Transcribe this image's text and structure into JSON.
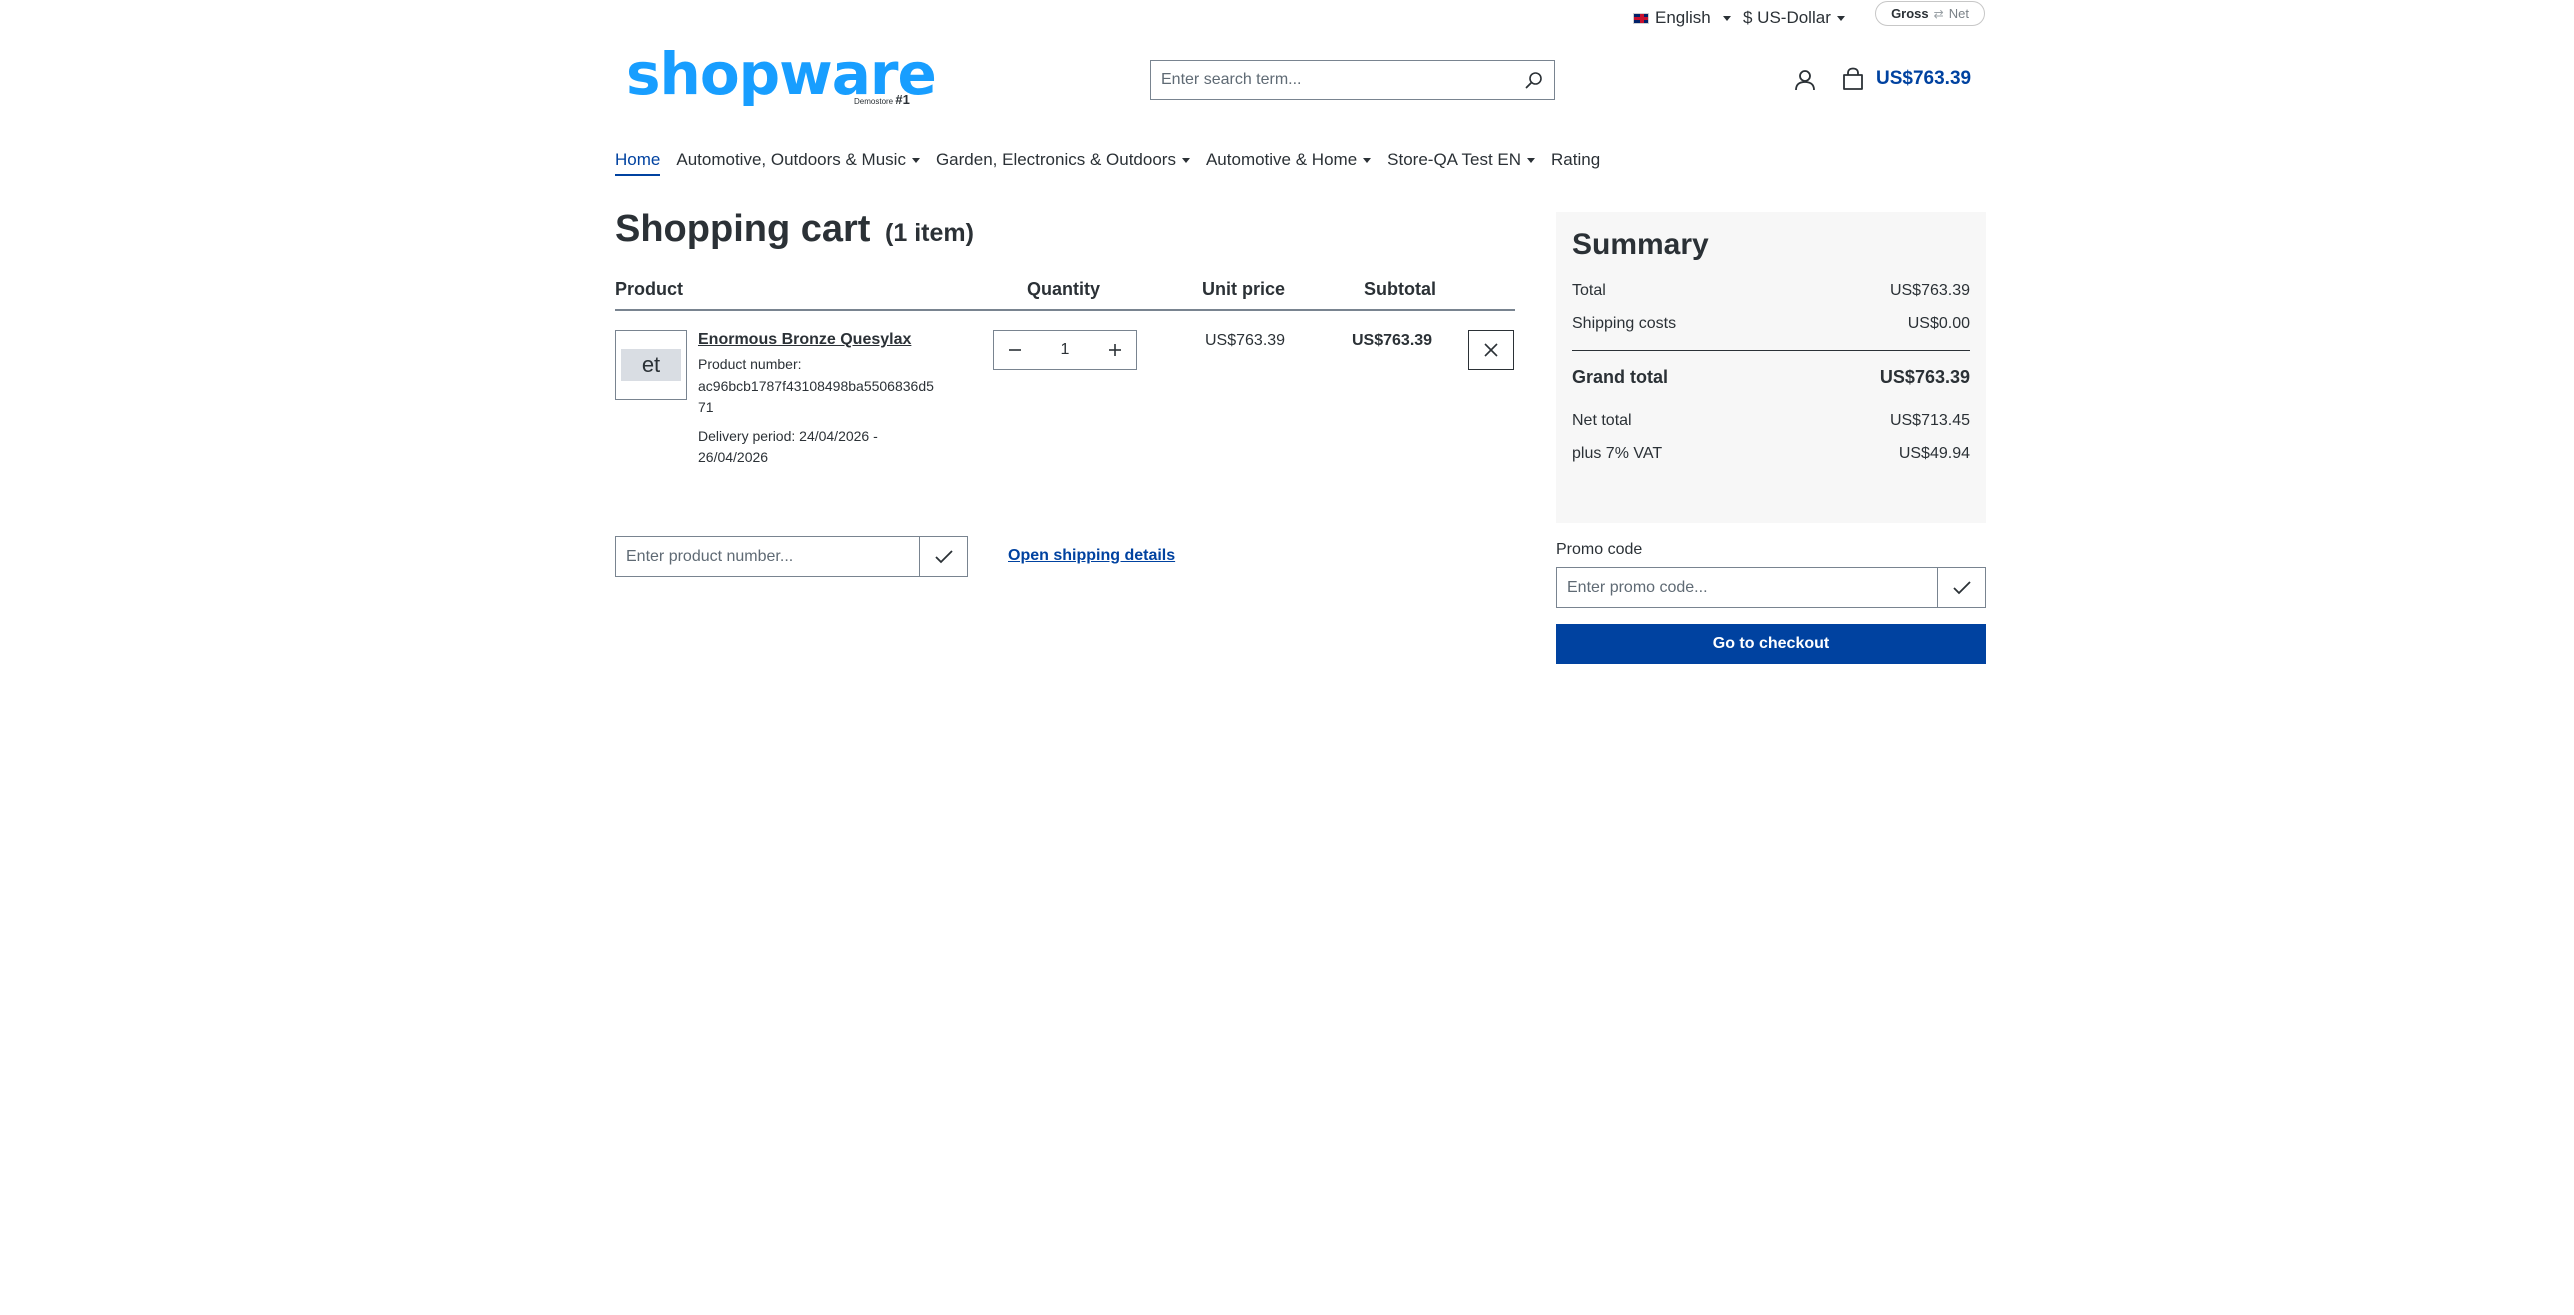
{
  "topbar": {
    "language": "English",
    "currency": "$ US-Dollar",
    "tax_toggle": {
      "gross": "Gross",
      "net": "Net",
      "selected": "Gross"
    }
  },
  "header": {
    "logo_text": "shopware",
    "logo_sub": "Demostore",
    "logo_sub_num": "#1",
    "search_placeholder": "Enter search term...",
    "cart_total": "US$763.39"
  },
  "nav": {
    "items": [
      {
        "label": "Home",
        "dropdown": false,
        "active": true
      },
      {
        "label": "Automotive, Outdoors & Music",
        "dropdown": true
      },
      {
        "label": "Garden, Electronics & Outdoors",
        "dropdown": true
      },
      {
        "label": "Automotive & Home",
        "dropdown": true
      },
      {
        "label": "Store-QA Test EN",
        "dropdown": true
      },
      {
        "label": "Rating",
        "dropdown": false
      }
    ]
  },
  "cart": {
    "title": "Shopping cart",
    "item_count": "(1 item)",
    "columns": {
      "product": "Product",
      "quantity": "Quantity",
      "unit_price": "Unit price",
      "subtotal": "Subtotal"
    },
    "line_items": [
      {
        "thumb_text": "et",
        "name": "Enormous Bronze Quesylax",
        "product_number_label": "Product number:",
        "product_number": "ac96bcb1787f43108498ba5506836d571",
        "delivery": "Delivery period: 24/04/2026 - 26/04/2026",
        "quantity": "1",
        "unit_price": "US$763.39",
        "subtotal": "US$763.39"
      }
    ],
    "add_product_placeholder": "Enter product number...",
    "shipping_link": "Open shipping details"
  },
  "summary": {
    "title": "Summary",
    "total_label": "Total",
    "total_value": "US$763.39",
    "shipping_label": "Shipping costs",
    "shipping_value": "US$0.00",
    "grand_label": "Grand total",
    "grand_value": "US$763.39",
    "net_label": "Net total",
    "net_value": "US$713.45",
    "vat_label": "plus 7% VAT",
    "vat_value": "US$49.94",
    "promo_label": "Promo code",
    "promo_placeholder": "Enter promo code...",
    "checkout_label": "Go to checkout"
  },
  "colors": {
    "brand": "#189eff",
    "accent": "#0042a0",
    "summary_bg": "#f7f7f7"
  },
  "icons": [
    "flag-uk-icon",
    "search-icon",
    "account-icon",
    "cart-icon",
    "minus-icon",
    "plus-icon",
    "close-icon",
    "checkmark-icon"
  ]
}
